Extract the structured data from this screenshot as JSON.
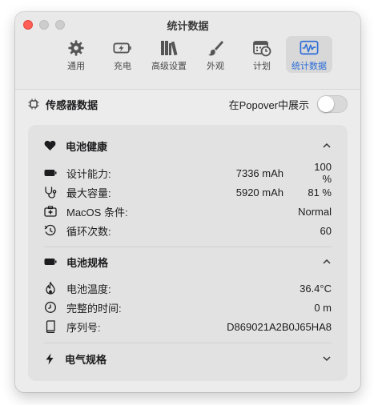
{
  "window": {
    "title": "统计数据"
  },
  "toolbar": {
    "items": [
      {
        "label": "通用"
      },
      {
        "label": "充电"
      },
      {
        "label": "高级设置"
      },
      {
        "label": "外观"
      },
      {
        "label": "计划"
      },
      {
        "label": "统计数据"
      }
    ]
  },
  "sensor": {
    "title": "传感器数据",
    "popover_label": "在Popover中展示",
    "popover_enabled": false
  },
  "battery_health": {
    "title": "电池健康",
    "rows": [
      {
        "label": "设计能力:",
        "value": "7336 mAh",
        "value2": "100 %"
      },
      {
        "label": "最大容量:",
        "value": "5920 mAh",
        "value2": "81 %"
      },
      {
        "label": "MacOS 条件:",
        "value": "Normal"
      },
      {
        "label": "循环次数:",
        "value": "60"
      }
    ]
  },
  "battery_specs": {
    "title": "电池规格",
    "rows": [
      {
        "label": "电池温度:",
        "value": "36.4°C"
      },
      {
        "label": "完整的时间:",
        "value": "0 m"
      },
      {
        "label": "序列号:",
        "value": "D869021A2B0J65HA8"
      }
    ]
  },
  "electrical_specs": {
    "title": "电气规格"
  },
  "colors": {
    "accent": "#2a6bd8",
    "close": "#ff5f57"
  }
}
